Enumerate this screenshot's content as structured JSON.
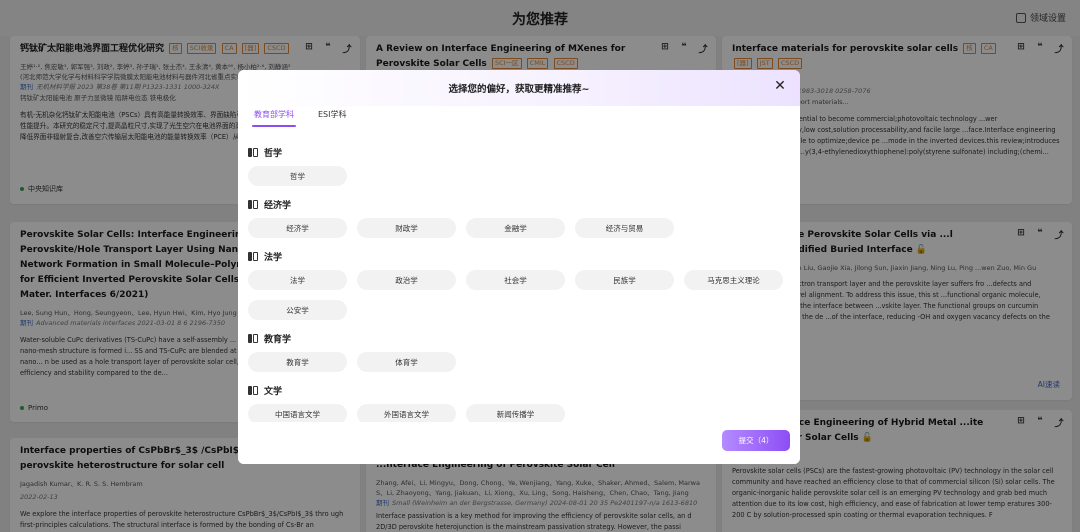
{
  "page": {
    "title": "为您推荐",
    "domain_settings": "领域设置"
  },
  "cards": [
    {
      "title": "钙钛矿太阳能电池界面工程优化研究",
      "tags": [
        "核",
        "SCI收录",
        "CA",
        "[器]",
        "CSCD"
      ],
      "authors": "王婷¹·², 焦宏敏³, 郭军强³, 刘政², 李婷³, 孙子瑞¹, 张士杰⁴, 王永清⁴, 黄本⁶⁰, 杨小柏²·⁶, 刘静涵³",
      "affiliation": "(河北师范大学化学与材料科学学院微膜太阳能电池材料与器件河北省重点实验室...)",
      "journal_prefix": "期刊",
      "journal": "无机材料学报 2023 第38卷 第11期 P1323-1331 1000-324X",
      "keywords": "钙钛矿太阳能电池  原子力显微镜  陷阱电位态  铁电极化",
      "abstract": "有机-无机杂化钙钛矿太阳能电池（PSCs）具有高能量转换效率、界面缺陷引起的非辐射复合严重阻碍了光电转换性能提升。本研究的稳定尺寸,提高晶粒尺寸,实现了光生空穴在电池界面的高效传递,溶剂作用时间提升结晶质量,降低界面非辐射复合,改善空穴传输层太阳能电池的能量转换效率（PCE）从10.11%提高到10.37%。开尔文",
      "source": "中央知识库"
    },
    {
      "title": "A Review on Interface Engineering of MXenes for Perovskite Solar Cells",
      "tags": [
        "SCI一区",
        "CMIL",
        "CSCD"
      ]
    },
    {
      "title": "Interface materials for perovskite solar cells",
      "tags": [
        "核",
        "CA",
        "[器]",
        "JST",
        "CSCD"
      ],
      "journal": "期刊 第40卷 第11期 P1983-3018 0258-7076",
      "keywords": "Interface  Hole transport materials...",
      "abstract": "...s exhibit great potential to become commercial;photovoltaic technology ...wer conversion;efficiency,low cost,solution processability,and facile large ...face.Interface engineering plays a significant role to optimize;device pe ...mode in the inverted devices.this review;introduces the progress on the ...y(3,4-ethylenedioxythiophene):poly(styrene sulfonate) including;(chemi..."
    },
    {
      "title": "Perovskite Solar Cells: Interface Engineering of Perovskite/Hole Transport Layer Using Nano-Network Formation in Small Molecule–Polymer Blend for Efficient Inverted Perovskite Solar Cells (Adv. Mater. Interfaces 6/2021)",
      "authors": "Lee, Sung Hun、Hong, Seungyeon、Lee, Hyun Hwi、Kim, Hyo Jung",
      "journal_prefix": "期刊",
      "journal": "Advanced materials interfaces 2021-03-01 8 6 2196-7350",
      "abstract": "Water-soluble CuPc derivatives (TS-CuPc) have a self-assembly ... OT:PSS. In particular, a unique nano-mesh structure is formed i... SS and TS-CuPc are blended at a specific volume ratio. The nano... n be used as a hole transport layer of perovskite solar cell, and... plied has increased efficiency and stability compared to the de...",
      "source": "Primo"
    },
    {
      "title": "...t and Stable Perovskite Solar Cells via ...l Curcumin Modified Buried Interface",
      "authors": "..., Guangtai Cu, Nian Liu, Gaojie Xia, Jilong Sun, Jiaxin Jiang, Ning Lu, Ping ...wen Zuo, Min Gu",
      "abstract": "...e between the electron transport layer and the perovskite layer suffers fro ...defects and imperfect energy level alignment. To address this issue, this st ...functional organic molecule, curcumin, to modify the interface between ...vskite layer. The functional groups on curcumin effectively passivate the de ...of the interface, reducing -OH and oxygen vacancy defects on the SnO2 ...",
      "ai_read": "AI速读"
    },
    {
      "title": "Interface properties of CsPbBr$_3$ /CsPbI$_3$ perovskite heterostructure for solar cell",
      "authors": "Jagadish Kumar、K. R. S. S. Hembram",
      "date": "2022-02-13",
      "abstract": "We explore the interface properties of perovskite heterostructure CsPbBr$_3$/CsPbI$_3$ thro ugh first-principles calculations. The structural interface is formed by the bonding of Cs-Br an"
    },
    {
      "title": "...nterface Engineering of Perovskite Solar Cell",
      "authors": "Zhang, Afei、Li, Mingyu、Dong, Chong、Ye, Wenjiang、Yang, Xuke、Shaker, Ahmed、Salem, Marwa S、Li, Zhaoyong、Yang, Jiakuan、Li, Xiong、Xu, Ling、Song, Haisheng、Chen, Chao、Tang, Jiang",
      "journal_prefix": "期刊",
      "journal": "Small (Weinheim an der Bergstrasse, Germany) 2024-08-01 20 35 Pe2401197-n/a 1613-6810",
      "abstract": "Interface passivation is a key method for improving the efficiency of perovskite solar cells, an d 2D/3D perovskite heterojunction is the mainstream passivation strategy. However, the passi"
    },
    {
      "title": "...and Interface Engineering of Hybrid Metal ...ite Thin Films for Solar Cells",
      "date": "2024-11-26",
      "abstract": "Perovskite solar cells (PSCs) are the fastest-growing photovoltaic (PV) technology in the solar cell community and have reached an efficiency close to that of commercial silicon (Si) solar cells. The organic-inorganic halide perovskite solar cell is an emerging PV technology and grab bed much attention due to its low cost, high efficiency, and ease of fabrication at lower temp eratures 300-200 C by solution-processed spin coating or thermal evaporation techniques. F"
    }
  ],
  "modal": {
    "title": "选择您的偏好，获取更精准推荐~",
    "tabs": [
      "教育部学科",
      "ESI学科"
    ],
    "active_tab": 0,
    "categories": [
      {
        "name": "哲学",
        "items": [
          "哲学"
        ]
      },
      {
        "name": "经济学",
        "items": [
          "经济学",
          "财政学",
          "金融学",
          "经济与贸易"
        ]
      },
      {
        "name": "法学",
        "items": [
          "法学",
          "政治学",
          "社会学",
          "民族学",
          "马克思主义理论",
          "公安学"
        ]
      },
      {
        "name": "教育学",
        "items": [
          "教育学",
          "体育学"
        ]
      },
      {
        "name": "文学",
        "items": [
          "中国语言文学",
          "外国语言文学",
          "新闻传播学"
        ]
      }
    ],
    "submit_label": "提交（4）"
  },
  "colors": {
    "accent": "#8b4ef0",
    "tag": "#e0883a",
    "link": "#3a68c7",
    "oa": "#3aa655"
  },
  "icons": {
    "card_actions": [
      "bookmark-icon",
      "quote-icon",
      "share-icon"
    ],
    "card_action_glyphs": [
      "⊞",
      "❝",
      "⤴"
    ],
    "oa_glyph": "🔓"
  }
}
